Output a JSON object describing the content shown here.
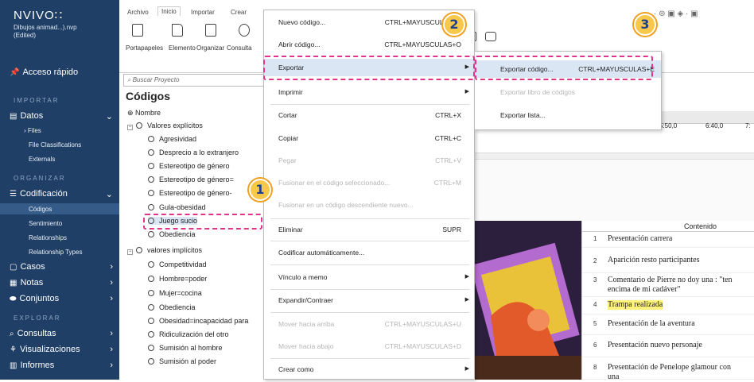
{
  "nav": {
    "logo": "NVIVO∷",
    "project": "Dibujos animad...).nvp",
    "project_state": "(Edited)",
    "quick_access": "Acceso rápido",
    "sections": {
      "import": "IMPORTAR",
      "organize": "ORGANIZAR",
      "explore": "EXPLORAR"
    },
    "data": "Datos",
    "data_items": [
      "Files",
      "File Classifications",
      "Externals"
    ],
    "coding": "Codificación",
    "coding_items": [
      "Códigos",
      "Sentimiento",
      "Relationships",
      "Relationship Types"
    ],
    "cases": "Casos",
    "notes": "Notas",
    "sets": "Conjuntos",
    "queries": "Consultas",
    "visualizations": "Visualizaciones",
    "reports": "Informes"
  },
  "ribbon": {
    "tabs": [
      "Archivo",
      "Inicio",
      "Importar",
      "Crear"
    ],
    "buttons": [
      "Portapapeles",
      "Elemento",
      "Organizar",
      "Consulta"
    ]
  },
  "codes_panel": {
    "search_placeholder": "Buscar Proyecto",
    "title": "Códigos",
    "column_name": "Nombre",
    "group1": "Valores explícitos",
    "group1_items": [
      "Agresividad",
      "Desprecio a lo extranjero",
      "Estereotipo de género",
      "Estereotipo de género=",
      "Estereotipo de género-",
      "Gula-obesidad",
      "Juego sucio",
      "Obediencia"
    ],
    "group2": "valores implícitos",
    "group2_items": [
      "Competitividad",
      "Hombre=poder",
      "Mujer=cocina",
      "Obediencia",
      "Obesidad=incapacidad para",
      "Ridiculización del otro",
      "Sumisión al hombre",
      "Sumisión al poder"
    ]
  },
  "context_menu": {
    "items": [
      {
        "label": "Nuevo código...",
        "shortcut": "CTRL+MAYUSCULAS+N",
        "disabled": false
      },
      {
        "label": "Abrir código...",
        "shortcut": "CTRL+MAYUSCULAS+O",
        "disabled": false
      },
      {
        "label": "Exportar",
        "shortcut": "",
        "disabled": false,
        "submenu": true
      },
      {
        "label": "Imprimir",
        "shortcut": "",
        "disabled": false,
        "submenu": true
      },
      {
        "label": "Cortar",
        "shortcut": "CTRL+X",
        "disabled": false
      },
      {
        "label": "Copiar",
        "shortcut": "CTRL+C",
        "disabled": false
      },
      {
        "label": "Pegar",
        "shortcut": "CTRL+V",
        "disabled": true
      },
      {
        "label": "Fusionar en el código seleccionado...",
        "shortcut": "CTRL+M",
        "disabled": true
      },
      {
        "label": "Fusionar en un código descendiente nuevo...",
        "shortcut": "",
        "disabled": true
      },
      {
        "label": "Eliminar",
        "shortcut": "SUPR",
        "disabled": false
      },
      {
        "label": "Codificar automáticamente...",
        "shortcut": "",
        "disabled": false
      },
      {
        "label": "Vínculo a memo",
        "shortcut": "",
        "disabled": false,
        "submenu": true
      },
      {
        "label": "Expandir/Contraer",
        "shortcut": "",
        "disabled": false,
        "submenu": true
      },
      {
        "label": "Mover hacia arriba",
        "shortcut": "CTRL+MAYUSCULAS+U",
        "disabled": true
      },
      {
        "label": "Mover hacia abajo",
        "shortcut": "CTRL+MAYUSCULAS+D",
        "disabled": true
      },
      {
        "label": "Crear como",
        "shortcut": "",
        "disabled": false,
        "submenu": true
      }
    ]
  },
  "submenu": {
    "items": [
      {
        "label": "Exportar código...",
        "shortcut": "CTRL+MAYUSCULAS+E",
        "disabled": false
      },
      {
        "label": "Exportar libro de códigos",
        "shortcut": "",
        "disabled": true
      },
      {
        "label": "Exportar lista...",
        "shortcut": "",
        "disabled": false
      }
    ]
  },
  "timeline": {
    "ticks": [
      "5:50,0",
      "6:40,0",
      "7:"
    ]
  },
  "transcript": {
    "header": "Contenido",
    "rows": [
      {
        "n": "1",
        "text": "Presentación carrera"
      },
      {
        "n": "2",
        "text": "Aparición resto participantes"
      },
      {
        "n": "3",
        "text": "Comentario de Pierre no doy una : \"ten",
        "text2": "encima de mi cadáver\""
      },
      {
        "n": "4",
        "text": "Trampa realizada",
        "highlight": true
      },
      {
        "n": "5",
        "text": "Presentación de la aventura"
      },
      {
        "n": "6",
        "text": "Presentación nuevo personaje"
      },
      {
        "n": "8",
        "text": "Presentación de Penelope glamour con",
        "text2": "una"
      }
    ]
  },
  "callouts": [
    "1",
    "2",
    "3"
  ],
  "colors": {
    "nav_bg": "#1f3f66",
    "highlight": "#e0338c",
    "badge": "#f7c84a",
    "selection": "#dbe6f4",
    "yellow": "#fff27a"
  }
}
